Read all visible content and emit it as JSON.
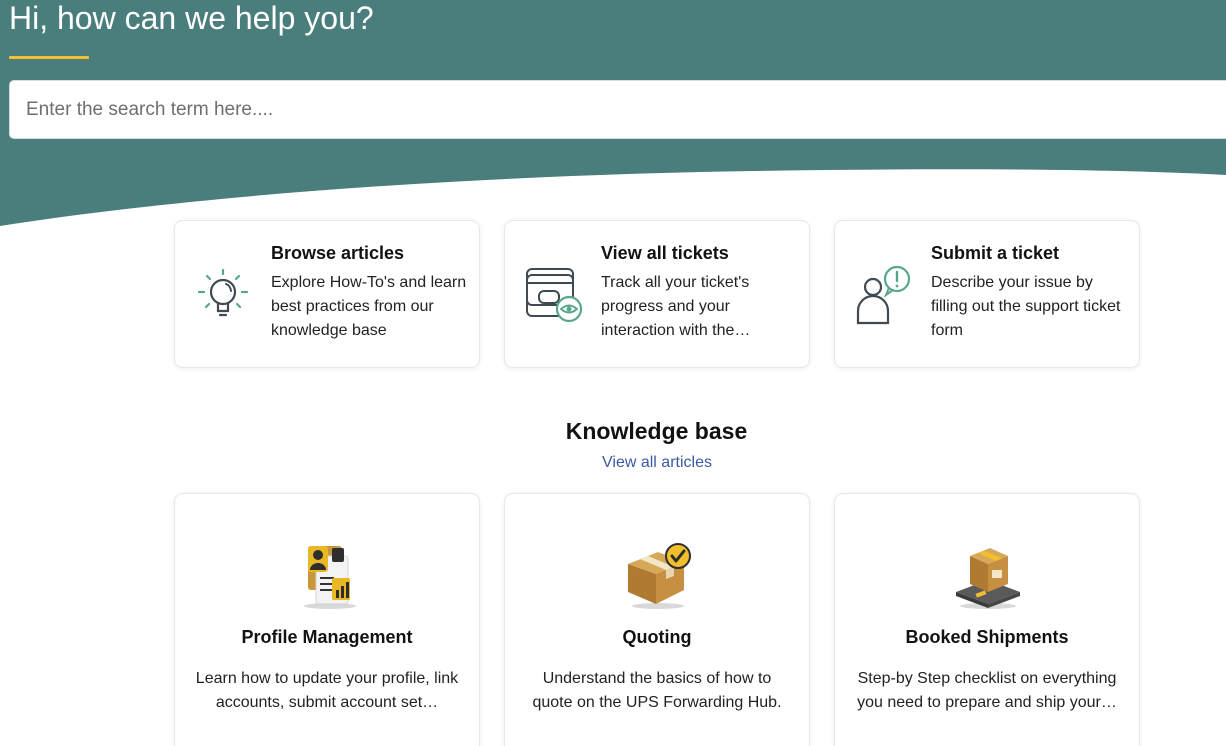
{
  "hero": {
    "title": "Hi, how can we help you?",
    "search_placeholder": "Enter the search term here....",
    "search_value": ""
  },
  "colors": {
    "hero_bg": "#4a7e7c",
    "accent_yellow": "#f2c230",
    "icon_teal": "#58a68c",
    "link_blue": "#3a5aa0"
  },
  "actions": [
    {
      "icon": "lightbulb-icon",
      "title": "Browse articles",
      "description": "Explore How-To's and learn best practices from our knowledge base"
    },
    {
      "icon": "tickets-eye-icon",
      "title": "View all tickets",
      "description": "Track all your ticket's progress and your interaction with the…"
    },
    {
      "icon": "person-alert-icon",
      "title": "Submit a ticket",
      "description": "Describe your issue by filling out the support ticket form"
    }
  ],
  "knowledge_base": {
    "heading": "Knowledge base",
    "view_all_label": "View all articles",
    "categories": [
      {
        "icon": "profile-document-icon",
        "title": "Profile Management",
        "description": "Learn how to update your profile, link accounts, submit account set…"
      },
      {
        "icon": "box-checkmark-icon",
        "title": "Quoting",
        "description": "Understand the basics of how to quote on the UPS Forwarding Hub."
      },
      {
        "icon": "box-on-scale-icon",
        "title": "Booked Shipments",
        "description": "Step-by Step checklist on everything you need to prepare and ship your…"
      }
    ]
  }
}
